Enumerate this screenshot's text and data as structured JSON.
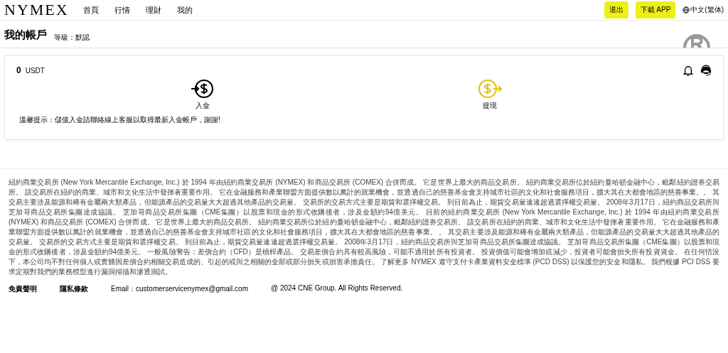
{
  "header": {
    "logo": "NYMEX",
    "nav": [
      {
        "label": "首頁"
      },
      {
        "label": "行情"
      },
      {
        "label": "理財"
      },
      {
        "label": "我的"
      }
    ],
    "buttons": [
      {
        "label": "退出"
      },
      {
        "label": "下載 APP"
      }
    ],
    "language": "中文(繁体)"
  },
  "account": {
    "title": "我的帳戶",
    "level": "等級：默認"
  },
  "wallet": {
    "balance": "0",
    "unit": "USDT",
    "actions": [
      {
        "kind": "deposit",
        "label": "入金"
      },
      {
        "kind": "withdraw",
        "label": "提現"
      }
    ],
    "notice": "溫馨提示：儲值入金請聯絡線上客服以取得最新入金帳戶，謝謝!"
  },
  "footer": {
    "disclaimer": "紐約商業交易所 (New York Mercantile Exchange, Inc.) 於 1994 年由紐約商業交易所 (NYMEX) 和商品交易所 (COMEX) 合併而成。 它是世界上最大的商品交易所。 紐約商業交易所位於紐約曼哈頓金融中心，毗鄰紐約證券交易所。 該交易所在紐約的商業、城市和文化生活中發揮著重要作用。 它在金融服務和產業聯盟方面提供數以萬計的就業機會，並透過自己的慈善基金會支持城市社區的文化和社會服務項目，擴大其在大都會地區的慈善事業。。 其交易主要涉及能源和稀有金屬兩大類產品，但能源產品的交易量大大超過其他產品的交易量。 交易所的交易方式主要是期貨和選擇權交易。 到目前為止，期貨交易量遠遠超過選擇權交易量。 2008年3月17日，紐約商品交易所與芝加哥商品交易所集團達成協議。 芝加哥商品交易所集團（CME集團）以股票和現金的形式收購後者，涉及金額約94億美元。 目前的紐約商業交易所 (New York Mercantile Exchange, Inc.) 於 1994 年由紐約商業交易所 (NYMEX) 和商品交易所 (COMEX) 合併而成。 它是世界上最大的商品交易所。 紐約商業交易所位於紐約曼哈頓金融中心，毗鄰紐約證券交易所。 該交易所在紐約的商業、城市和文化生活中發揮著重要作用。 它在金融服務和產業聯盟方面提供數以萬計的就業機會，並透過自己的慈善基金會支持城市社區的文化和社會服務項目，擴大其在大都會地區的慈善事業。 。 其交易主要涉及能源和稀有金屬兩大類產品，但能源產品的交易量大大超過其他產品的交易量。 交易所的交易方式主要是期貨和選擇權交易。 到目前為止，期貨交易量遠遠超過選擇權交易量。 2008年3月17日，紐約商品交易所與芝加哥商品交易所集團達成協議。 芝加哥商品交易所集團（CME集團）以股票和現金的形式收購後者，涉及金額約94億美元。 一般風險警告：差價合約（CFD）是槓桿產品。 交易差價合約具有較高風險，可能不適用於所有投資者。 投資價值可能會增加或減少，投資者可能會損失所有投資資金。 在任何情況下，本公司均不對任何個人或實體因差價合約相關交易造成的、引起的或與之相關的全部或部分損失或損害承擔責任。 了解更多 NYMEX 遵守支付卡產業資料安全標準 (PCD DSS) 以保護您的安全和隱私。 我們根據 PCI DSS 要求定期對我們的業務模型進行漏洞掃描和滲透測試。",
    "links": [
      {
        "label": "免責聲明"
      },
      {
        "label": "隱私條款"
      }
    ],
    "email": "Email：customerservicenymex@gmail.com",
    "copyright": "@ 2024 CNE Group. All Rights Reserved."
  }
}
